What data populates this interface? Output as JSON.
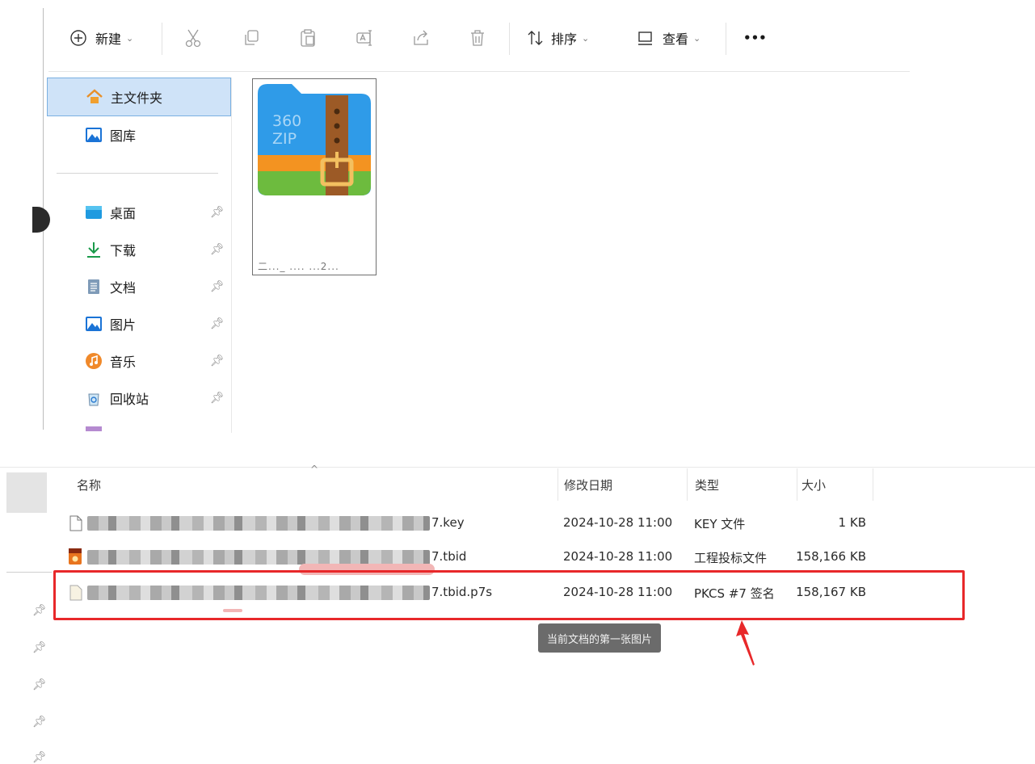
{
  "toolbar": {
    "new_label": "新建",
    "sort_label": "排序",
    "view_label": "查看",
    "more_label": "•••"
  },
  "nav": {
    "items": [
      {
        "label": "主文件夹"
      },
      {
        "label": "图库"
      },
      {
        "label": "桌面"
      },
      {
        "label": "下载"
      },
      {
        "label": "文档"
      },
      {
        "label": "图片"
      },
      {
        "label": "音乐"
      },
      {
        "label": "回收站"
      }
    ]
  },
  "tile": {
    "logo_line1": "360",
    "logo_line2": "ZIP",
    "name": "二..._ .... ...2..."
  },
  "details": {
    "columns": {
      "name": "名称",
      "modified": "修改日期",
      "type": "类型",
      "size": "大小"
    },
    "rows": [
      {
        "name": "7.key",
        "modified": "2024-10-28 11:00",
        "type": "KEY 文件",
        "size": "1 KB"
      },
      {
        "name": "7.tbid",
        "modified": "2024-10-28 11:00",
        "type": "工程投标文件",
        "size": "158,166 KB"
      },
      {
        "name": "7.tbid.p7s",
        "modified": "2024-10-28 11:00",
        "type": "PKCS #7 签名",
        "size": "158,167 KB"
      }
    ],
    "tooltip": "当前文档的第一张图片"
  },
  "colors": {
    "highlight": "#e8282a",
    "selection": "#cfe3f8",
    "arrow": "#e8282a"
  }
}
